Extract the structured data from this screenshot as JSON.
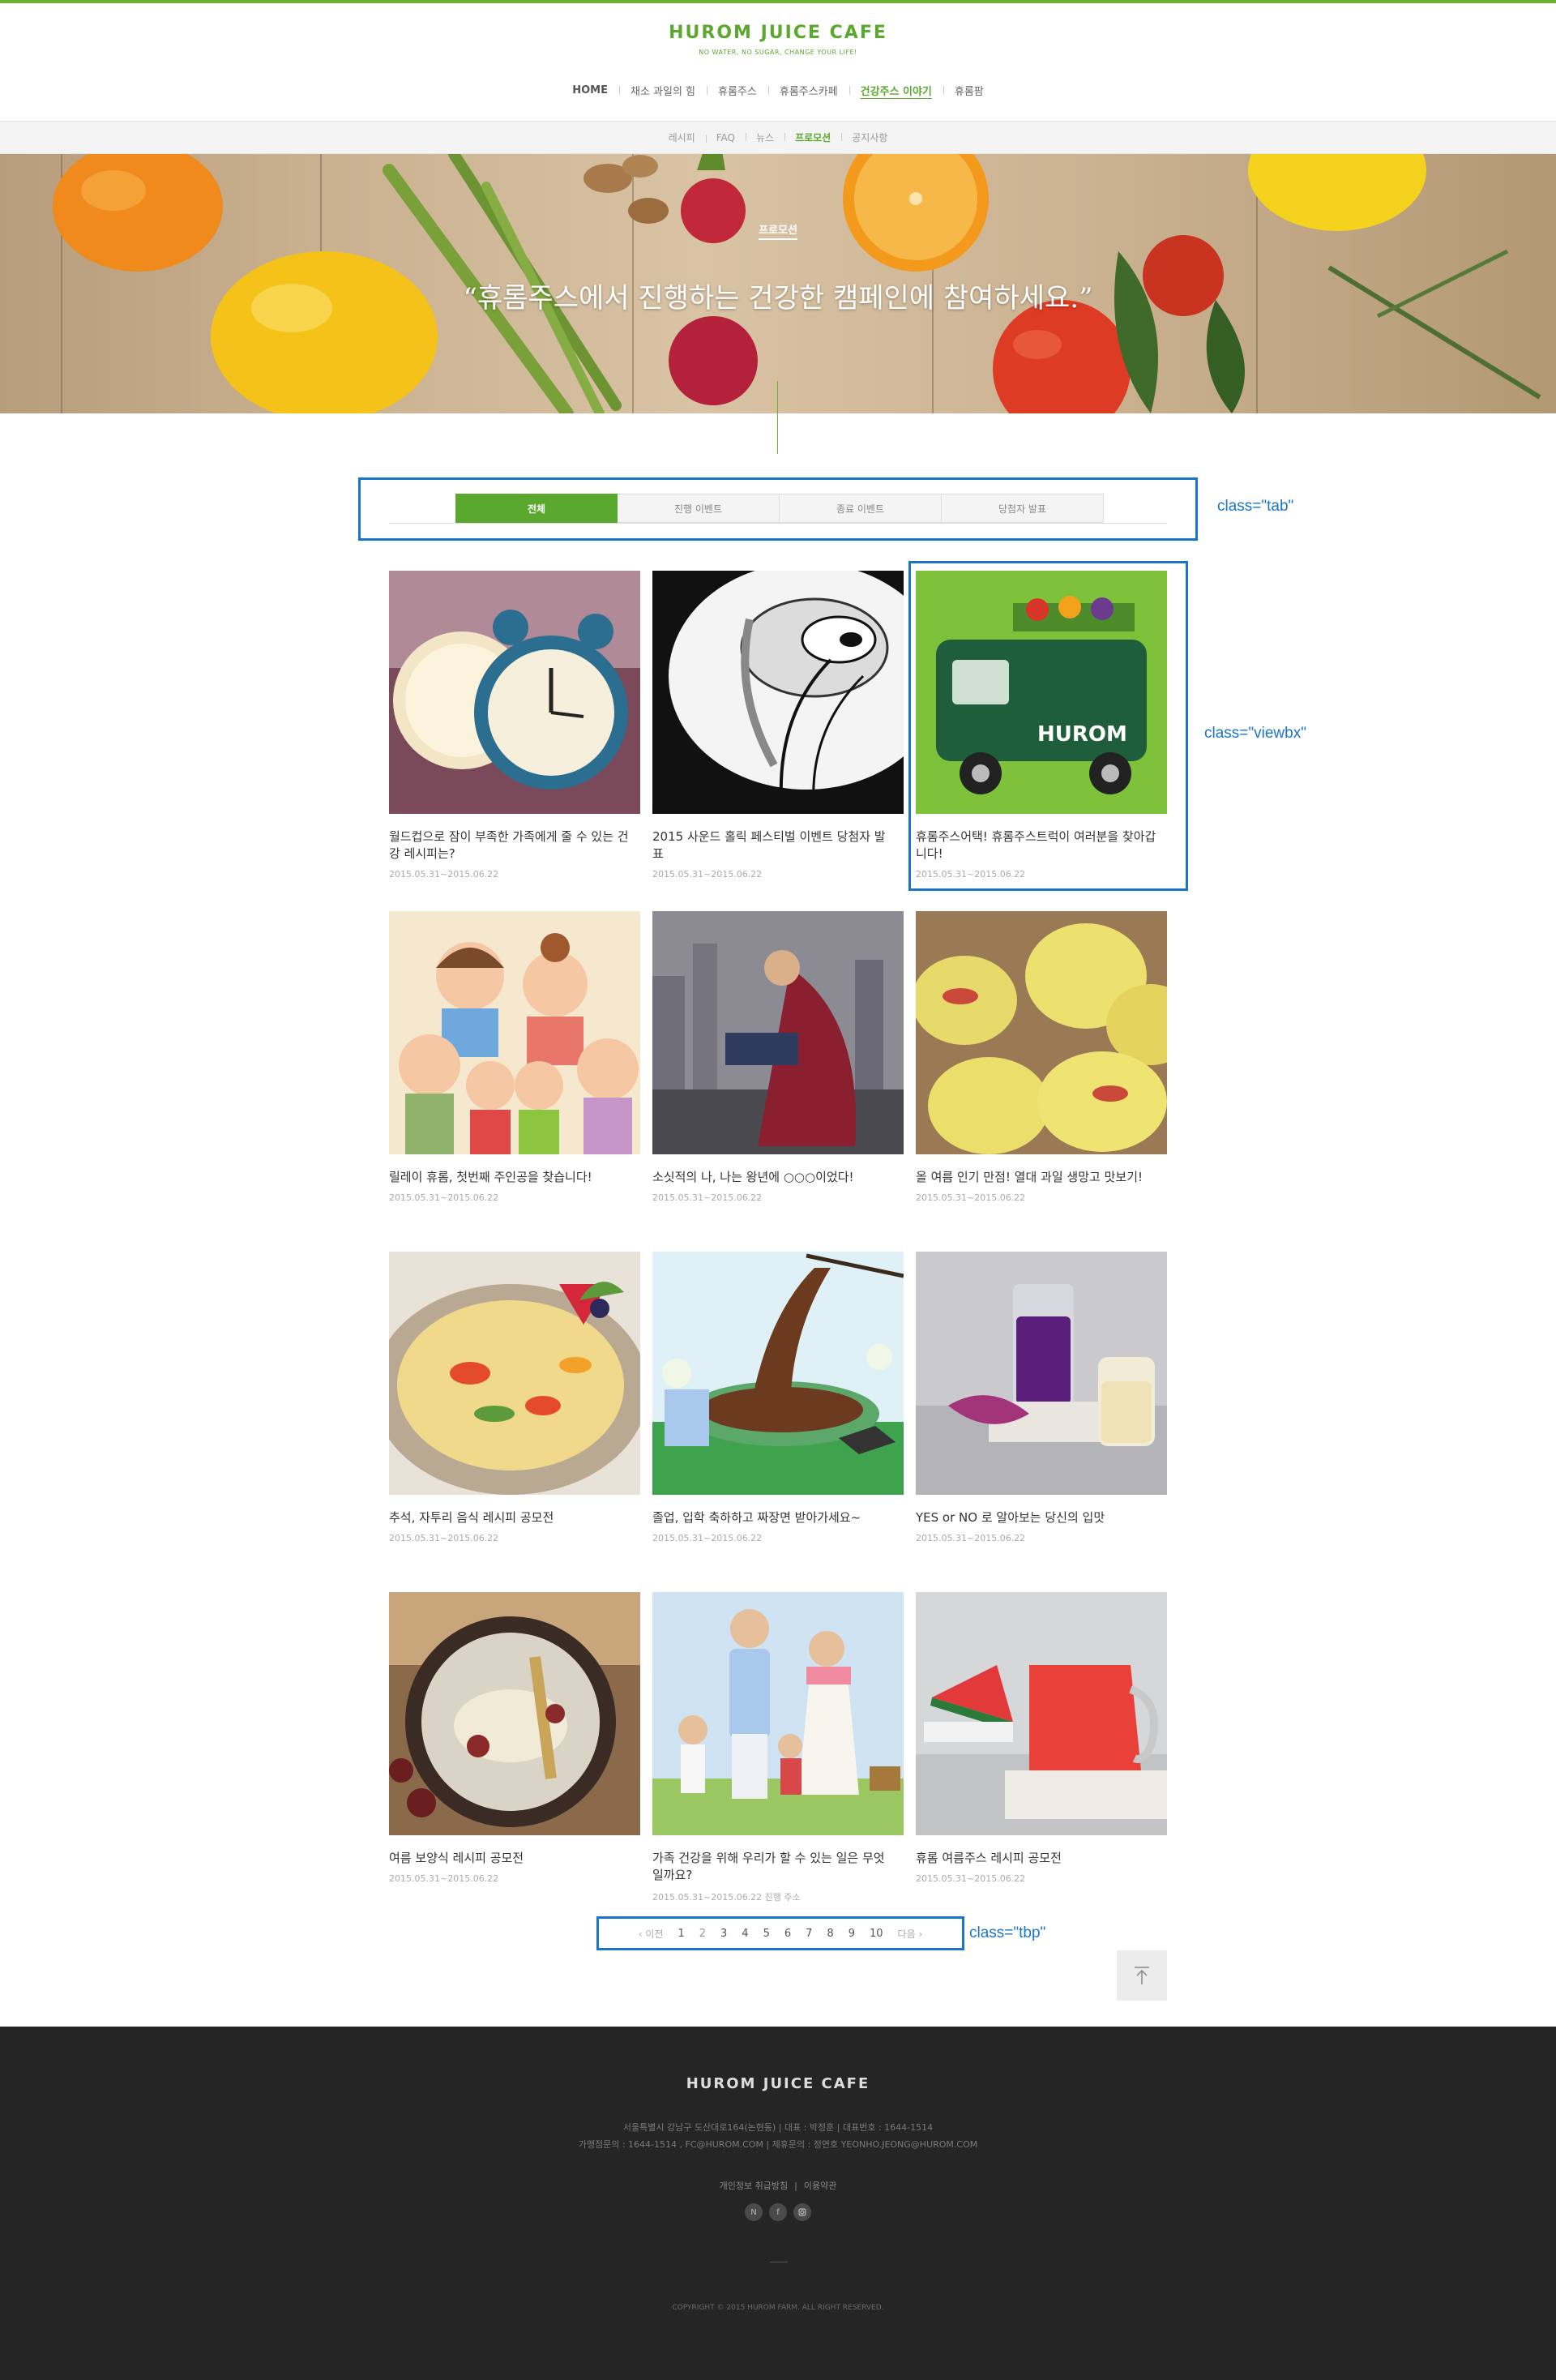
{
  "header": {
    "logo": "HUROM JUICE CAFE",
    "tagline": "NO WATER, NO SUGAR, CHANGE YOUR LIFE!",
    "gnb": [
      {
        "label": "HOME"
      },
      {
        "label": "채소 과일의 힘"
      },
      {
        "label": "휴롬주스"
      },
      {
        "label": "휴롬주스카페"
      },
      {
        "label": "건강주스 이야기",
        "active": true
      },
      {
        "label": "휴롬팜"
      }
    ]
  },
  "subnav": [
    {
      "label": "레시피"
    },
    {
      "label": "FAQ"
    },
    {
      "label": "뉴스"
    },
    {
      "label": "프로모션",
      "active": true
    },
    {
      "label": "공지사항"
    }
  ],
  "hero": {
    "badge": "프로모션",
    "title": "“휴롬주스에서 진행하는 건강한 캠페인에 참여하세요.”"
  },
  "annotations": {
    "tab": "class=\"tab\"",
    "viewbx": "class=\"viewbx\"",
    "tbp": "class=\"tbp\""
  },
  "tabs": [
    {
      "label": "전체",
      "active": true
    },
    {
      "label": "진행 이벤트"
    },
    {
      "label": "종료 이벤트"
    },
    {
      "label": "당첨자 발표"
    }
  ],
  "cards": [
    {
      "title": "월드컵으로 잠이 부족한 가족에게 줄 수 있는 건강 레시피는?",
      "date": "2015.05.31~2015.06.22",
      "image": "alarm-clocks"
    },
    {
      "title": "2015 사운드 홀릭 페스티벌 이벤트 당첨자 발표",
      "date": "2015.05.31~2015.06.22",
      "image": "headphones"
    },
    {
      "title": "휴롬주스어택! 휴롬주스트럭이 여러분을 찾아갑니다!",
      "date": "2015.05.31~2015.06.22",
      "image": "juice-truck"
    },
    {
      "title": "릴레이 휴롬, 첫번째 주인공을 찾습니다!",
      "date": "2015.05.31~2015.06.22",
      "image": "family-cartoon"
    },
    {
      "title": "소싯적의 나, 나는 왕년에 ○○○이었다!",
      "date": "2015.05.31~2015.06.22",
      "image": "caped-man"
    },
    {
      "title": "올 여름 인기 만점! 열대 과일 생망고 맛보기!",
      "date": "2015.05.31~2015.06.22",
      "image": "mangoes"
    },
    {
      "title": "추석, 자투리 음식 레시피 공모전",
      "date": "2015.05.31~2015.06.22",
      "image": "pancake"
    },
    {
      "title": "졸업, 입학 축하하고 짜장면 받아가세요~",
      "date": "2015.05.31~2015.06.22",
      "image": "jjajang-noodles"
    },
    {
      "title": "YES or NO 로 알아보는 당신의 입맛",
      "date": "2015.05.31~2015.06.22",
      "image": "purple-juice"
    },
    {
      "title": "여름 보양식 레시피 공모전",
      "date": "2015.05.31~2015.06.22",
      "image": "samgyetang"
    },
    {
      "title": "가족 건강을 위해 우리가 할 수 있는 일은 무엇일까요?",
      "date": "2015.05.31~2015.06.22 진행 주소",
      "image": "family-photo"
    },
    {
      "title": "휴롬 여름주스 레시피 공모전",
      "date": "2015.05.31~2015.06.22",
      "image": "watermelon-juice"
    }
  ],
  "pagination": {
    "prev": "‹ 이전",
    "next": "다음 ›",
    "pages": [
      "1",
      "2",
      "3",
      "4",
      "5",
      "6",
      "7",
      "8",
      "9",
      "10"
    ],
    "current": "2"
  },
  "footer": {
    "logo": "HUROM JUICE CAFE",
    "line1": "서울특별시 강남구 도산대로164(논현동)  |  대표 : 박정훈  |  대표번호 : 1644-1514",
    "line2": "가맹점문의 : 1644-1514 , FC@HUROM.COM  |  제휴문의 : 정연호 YEONHO.JEONG@HUROM.COM",
    "links": [
      "개인정보 취급방침",
      "이용약관"
    ],
    "social": [
      "blog-icon",
      "facebook-icon",
      "instagram-icon"
    ],
    "copyright": "COPYRIGHT © 2015 HUROM FARM. ALL RIGHT RESERVED."
  },
  "colors": {
    "brand": "#5aa82d",
    "annotation": "#1a75c9",
    "footer_bg": "#252525"
  }
}
